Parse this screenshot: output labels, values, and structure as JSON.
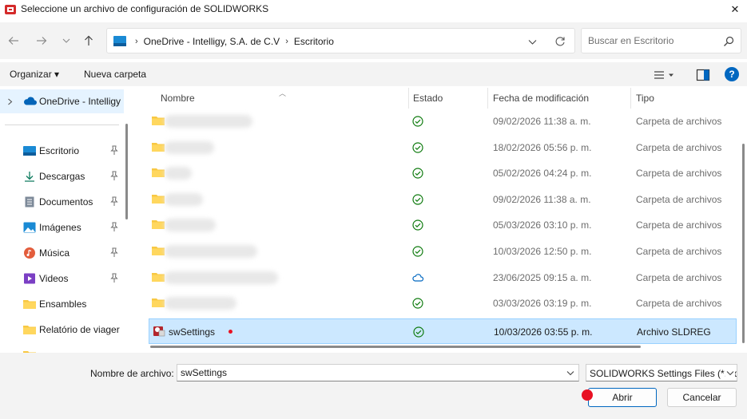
{
  "window": {
    "title": "Seleccione un archivo de configuración de SOLIDWORKS",
    "close_glyph": "✕"
  },
  "address": {
    "breadcrumbs": [
      "OneDrive - Intelligy, S.A. de C.V",
      "Escritorio"
    ]
  },
  "search": {
    "placeholder": "Buscar en Escritorio"
  },
  "toolbar": {
    "organize_label": "Organizar ▾",
    "new_folder_label": "Nueva carpeta",
    "help_label": "?"
  },
  "nav": {
    "onedrive_label": "OneDrive - Intelligy",
    "items": [
      {
        "label": "Escritorio",
        "icon": "desktop-icon",
        "pinned": true
      },
      {
        "label": "Descargas",
        "icon": "download-icon",
        "pinned": true
      },
      {
        "label": "Documentos",
        "icon": "document-icon",
        "pinned": true
      },
      {
        "label": "Imágenes",
        "icon": "image-icon",
        "pinned": true
      },
      {
        "label": "Música",
        "icon": "music-icon",
        "pinned": true
      },
      {
        "label": "Videos",
        "icon": "video-icon",
        "pinned": true
      },
      {
        "label": "Ensambles",
        "icon": "folder-icon",
        "pinned": false
      },
      {
        "label": "Relatório de viager",
        "icon": "folder-icon",
        "pinned": false
      }
    ]
  },
  "columns": {
    "name": "Nombre",
    "status": "Estado",
    "date": "Fecha de modificación",
    "type": "Tipo"
  },
  "files": [
    {
      "name": "",
      "date": "09/02/2026 11:38 a. m.",
      "type": "Carpeta de archivos",
      "status": "synced"
    },
    {
      "name": "",
      "date": "18/02/2026 05:56 p. m.",
      "type": "Carpeta de archivos",
      "status": "synced"
    },
    {
      "name": "",
      "date": "05/02/2026 04:24 p. m.",
      "type": "Carpeta de archivos",
      "status": "synced"
    },
    {
      "name": "",
      "date": "09/02/2026 11:38 a. m.",
      "type": "Carpeta de archivos",
      "status": "synced"
    },
    {
      "name": "",
      "date": "05/03/2026 03:10 p. m.",
      "type": "Carpeta de archivos",
      "status": "synced"
    },
    {
      "name": "",
      "date": "10/03/2026 12:50 p. m.",
      "type": "Carpeta de archivos",
      "status": "synced"
    },
    {
      "name": "",
      "date": "23/06/2025 09:15 a. m.",
      "type": "Carpeta de archivos",
      "status": "cloud"
    },
    {
      "name": "",
      "date": "03/03/2026 03:19 p. m.",
      "type": "Carpeta de archivos",
      "status": "synced"
    },
    {
      "name": "swSettings",
      "date": "10/03/2026 03:55 p. m.",
      "type": "Archivo SLDREG",
      "status": "synced"
    }
  ],
  "footer": {
    "filename_label": "Nombre de archivo:",
    "filename_value": "swSettings",
    "filetype_value": "SOLIDWORKS Settings Files (*.sldreg)",
    "open_label": "Abrir",
    "cancel_label": "Cancelar"
  },
  "colors": {
    "accent": "#0067c0",
    "selection": "#cce8ff",
    "marker": "#e81123",
    "folder": "#f8c843",
    "synced": "#0f7b0f",
    "cloud": "#0067c0"
  }
}
